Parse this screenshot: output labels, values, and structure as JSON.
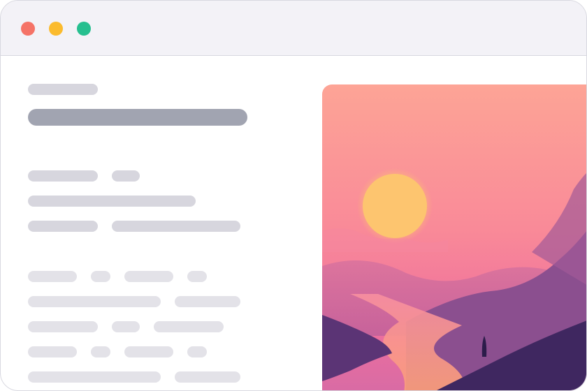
{
  "window": {
    "controls": [
      {
        "name": "close-button",
        "color": "#f57367"
      },
      {
        "name": "minimize-button",
        "color": "#fbbb2d"
      },
      {
        "name": "zoom-button",
        "color": "#26bf8f"
      }
    ]
  },
  "content": {
    "placeholder_colors": {
      "light": "#e3e2e8",
      "mid": "#d7d6de",
      "dark": "#a1a4b1"
    }
  },
  "hero_image": {
    "icon": "sunset-landscape-illustration",
    "colors": {
      "sky_top": "#fda496",
      "sky_bottom": "#f3739c",
      "sun": "#fdc56f",
      "mountains": "#8b4f8f",
      "river": "#fca173",
      "foreground": "#3f2760"
    }
  }
}
